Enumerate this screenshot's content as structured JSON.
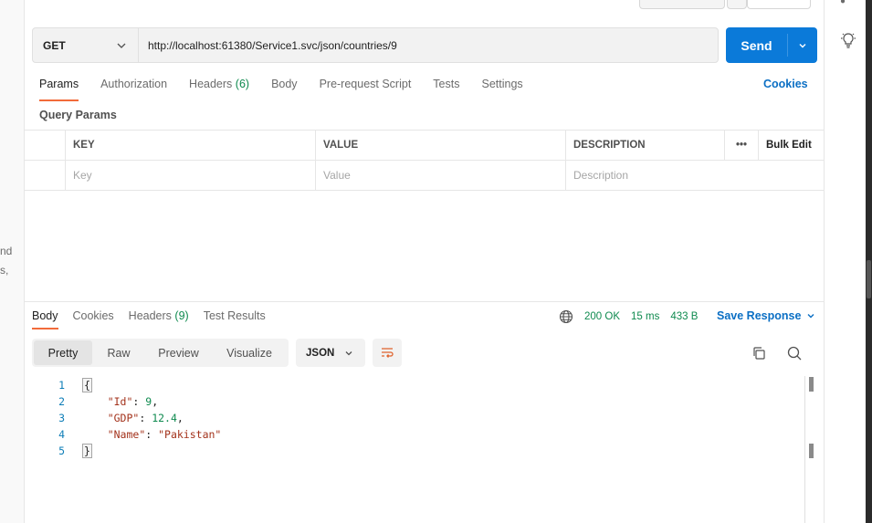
{
  "left_fragments": [
    "nd",
    "s,"
  ],
  "request": {
    "method": "GET",
    "url": "http://localhost:61380/Service1.svc/json/countries/9",
    "send_label": "Send"
  },
  "request_tabs": [
    {
      "label": "Params",
      "count": "",
      "active": true
    },
    {
      "label": "Authorization",
      "count": "",
      "active": false
    },
    {
      "label": "Headers",
      "count": "(6)",
      "active": false
    },
    {
      "label": "Body",
      "count": "",
      "active": false
    },
    {
      "label": "Pre-request Script",
      "count": "",
      "active": false
    },
    {
      "label": "Tests",
      "count": "",
      "active": false
    },
    {
      "label": "Settings",
      "count": "",
      "active": false
    }
  ],
  "cookies_label": "Cookies",
  "query_params": {
    "title": "Query Params",
    "columns": [
      "KEY",
      "VALUE",
      "DESCRIPTION"
    ],
    "more_glyph": "•••",
    "bulk_edit": "Bulk Edit",
    "placeholders": [
      "Key",
      "Value",
      "Description"
    ]
  },
  "response_tabs": [
    {
      "label": "Body",
      "count": "",
      "active": true
    },
    {
      "label": "Cookies",
      "count": "",
      "active": false
    },
    {
      "label": "Headers",
      "count": "(9)",
      "active": false
    },
    {
      "label": "Test Results",
      "count": "",
      "active": false
    }
  ],
  "status": {
    "code": "200 OK",
    "time": "15 ms",
    "size": "433 B"
  },
  "save_response": "Save Response",
  "view_modes": [
    {
      "label": "Pretty",
      "active": true
    },
    {
      "label": "Raw",
      "active": false
    },
    {
      "label": "Preview",
      "active": false
    },
    {
      "label": "Visualize",
      "active": false
    }
  ],
  "format": "JSON",
  "response_body": {
    "line_numbers": [
      "1",
      "2",
      "3",
      "4",
      "5"
    ],
    "open_brace": "{",
    "close_brace": "}",
    "fields": [
      {
        "key": "\"Id\"",
        "value": "9",
        "kind": "number",
        "trail": ","
      },
      {
        "key": "\"GDP\"",
        "value": "12.4",
        "kind": "number",
        "trail": ","
      },
      {
        "key": "\"Name\"",
        "value": "\"Pakistan\"",
        "kind": "string",
        "trail": ""
      }
    ]
  },
  "colors": {
    "accent": "#0b7ad9",
    "tab_underline": "#f26b3a",
    "success": "#0f8a4f",
    "link": "#0b6fc4"
  }
}
